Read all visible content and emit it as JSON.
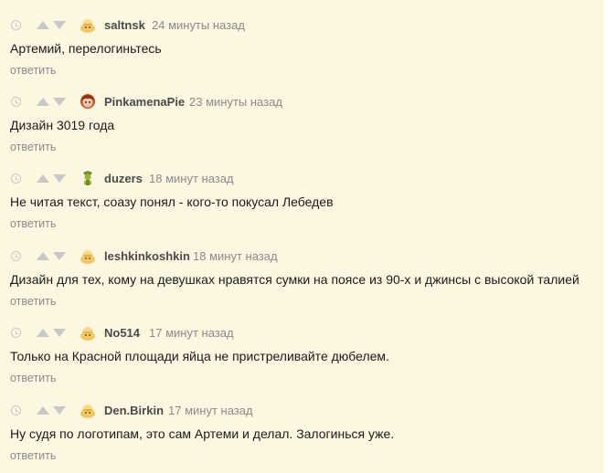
{
  "reply_label": "ответить",
  "colors": {
    "background": "#fdf7e1",
    "vote_arrow": "#c7c7c7",
    "meta_text": "#8a8a8a",
    "username": "#4a4a4a"
  },
  "comments": [
    {
      "username": "saltnsk",
      "time": "24 минуты назад",
      "text": "Артемий, перелогиньтесь",
      "avatar_icon": "default-avatar-icon"
    },
    {
      "username": "PinkamenaPie",
      "time": "23 минуты назад",
      "text": "Дизайн 3019 года",
      "avatar_icon": "pony-avatar-icon"
    },
    {
      "username": "duzers",
      "time": "18 минут назад",
      "text": "Не читая текст, соазу понял - кого-то покусал Лебедев",
      "avatar_icon": "goblin-avatar-icon"
    },
    {
      "username": "leshkinkoshkin",
      "time": "18 минут назад",
      "text": "Дизайн для тех, кому на девушках нравятся сумки на поясе из 90-х и джинсы с высокой талией",
      "avatar_icon": "default-avatar-icon"
    },
    {
      "username": "No514",
      "time": "17 минут назад",
      "text": "Только на Красной площади яйца не пристреливайте дюбелем.",
      "avatar_icon": "default-avatar-icon"
    },
    {
      "username": "Den.Birkin",
      "time": "17 минут назад",
      "text": "Ну судя по логотипам, это сам Артеми и делал. Залогинься уже.",
      "avatar_icon": "default-avatar-icon"
    }
  ]
}
